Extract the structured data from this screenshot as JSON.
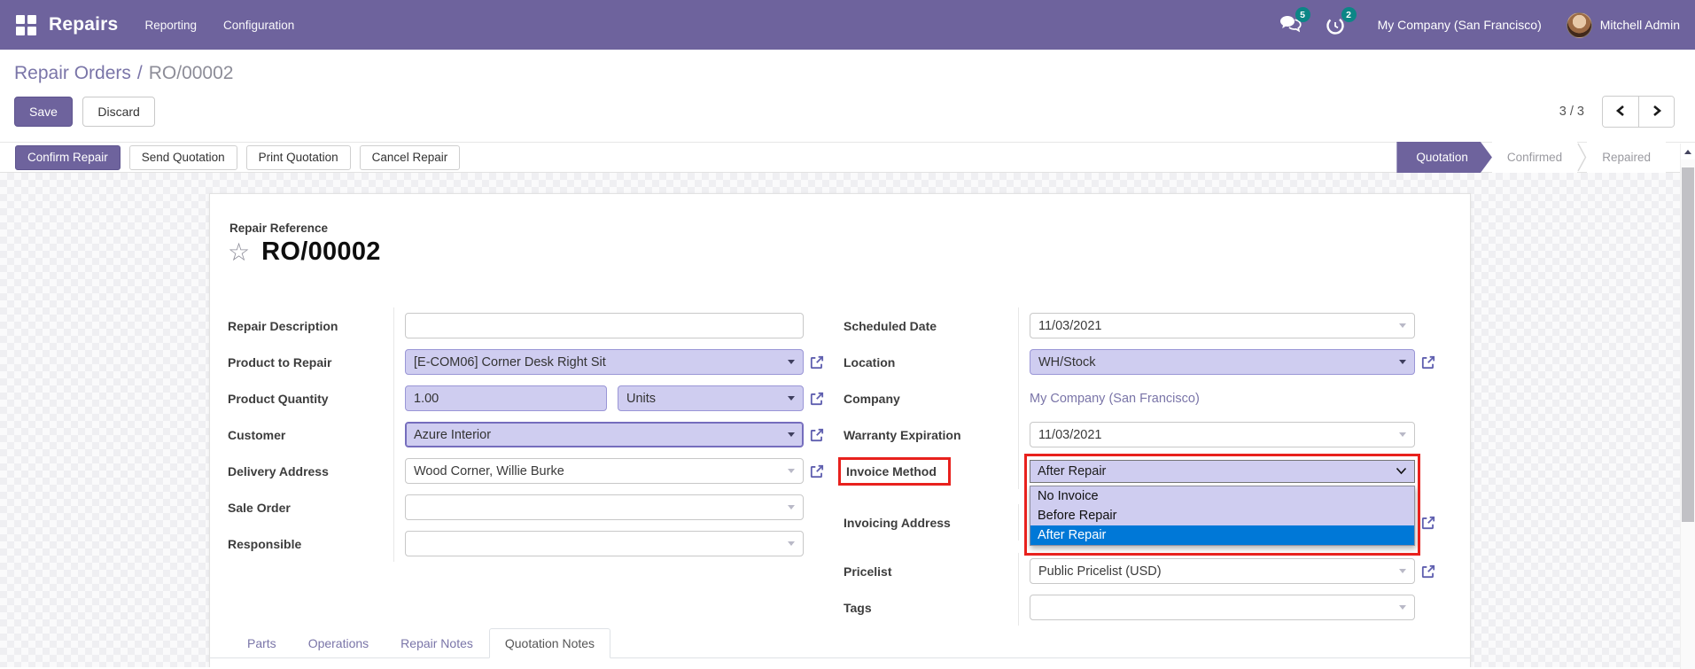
{
  "nav": {
    "app_name": "Repairs",
    "menus": [
      "Reporting",
      "Configuration"
    ],
    "messages_count": "5",
    "activities_count": "2",
    "company": "My Company (San Francisco)",
    "user": "Mitchell Admin"
  },
  "breadcrumb": {
    "parent": "Repair Orders",
    "separator": "/",
    "current": "RO/00002"
  },
  "actions": {
    "save": "Save",
    "discard": "Discard",
    "pager": "3 / 3"
  },
  "statusbar": {
    "buttons": [
      "Confirm Repair",
      "Send Quotation",
      "Print Quotation",
      "Cancel Repair"
    ],
    "steps": [
      {
        "label": "Quotation",
        "active": true
      },
      {
        "label": "Confirmed",
        "active": false
      },
      {
        "label": "Repaired",
        "active": false
      }
    ]
  },
  "form": {
    "reference_label": "Repair Reference",
    "reference": "RO/00002",
    "fields": {
      "repair_description": {
        "label": "Repair Description",
        "value": ""
      },
      "product_to_repair": {
        "label": "Product to Repair",
        "value": "[E-COM06] Corner Desk Right Sit"
      },
      "product_quantity": {
        "label": "Product Quantity",
        "value": "1.00",
        "uom": "Units"
      },
      "customer": {
        "label": "Customer",
        "value": "Azure Interior"
      },
      "delivery_address": {
        "label": "Delivery Address",
        "value": "Wood Corner, Willie Burke"
      },
      "sale_order": {
        "label": "Sale Order",
        "value": ""
      },
      "responsible": {
        "label": "Responsible",
        "value": ""
      },
      "scheduled_date": {
        "label": "Scheduled Date",
        "value": "11/03/2021"
      },
      "location": {
        "label": "Location",
        "value": "WH/Stock"
      },
      "company": {
        "label": "Company",
        "value": "My Company (San Francisco)"
      },
      "warranty_expiration": {
        "label": "Warranty Expiration",
        "value": "11/03/2021"
      },
      "invoice_method": {
        "label": "Invoice Method",
        "value": "After Repair",
        "options": [
          "No Invoice",
          "Before Repair",
          "After Repair"
        ],
        "highlighted": "After Repair"
      },
      "invoicing_address": {
        "label": "Invoicing Address",
        "value": ""
      },
      "pricelist": {
        "label": "Pricelist",
        "value": "Public Pricelist (USD)"
      },
      "tags": {
        "label": "Tags",
        "value": ""
      }
    },
    "tabs": [
      {
        "label": "Parts",
        "active": false
      },
      {
        "label": "Operations",
        "active": false
      },
      {
        "label": "Repair Notes",
        "active": false
      },
      {
        "label": "Quotation Notes",
        "active": true
      }
    ]
  },
  "colors": {
    "navbar": "#6e639d",
    "lav": "#cfcdf0",
    "hl": "#0078d7",
    "red": "#e8211d",
    "badge": "#0c8686",
    "link": "#7a75a8"
  }
}
